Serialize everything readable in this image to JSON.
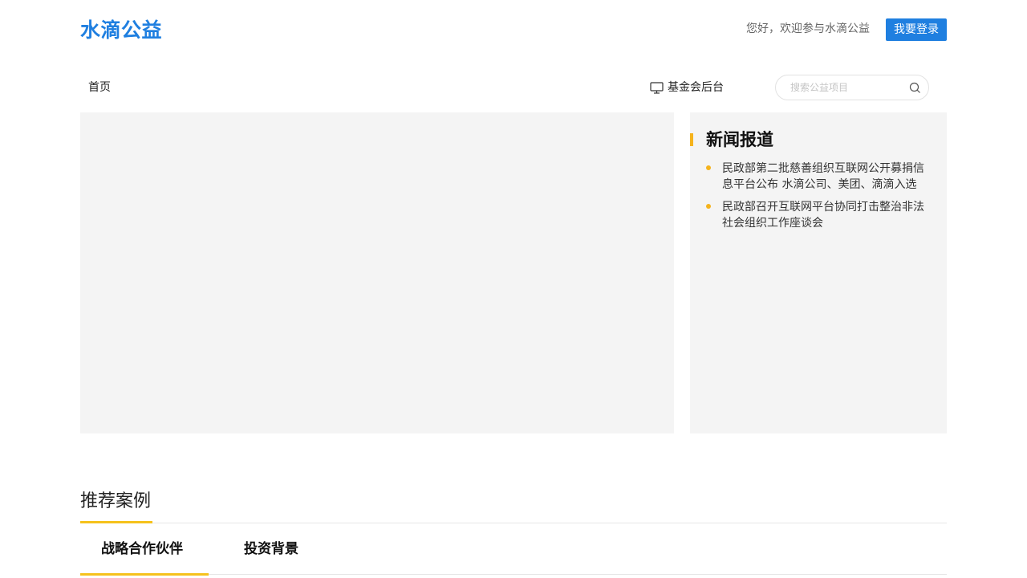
{
  "header": {
    "logo": "水滴公益",
    "greeting": "您好，欢迎参与水滴公益",
    "login_label": "我要登录"
  },
  "nav": {
    "home_label": "首页",
    "admin_label": "基金会后台",
    "search_placeholder": "搜索公益项目"
  },
  "news": {
    "title": "新闻报道",
    "items": [
      "民政部第二批慈善组织互联网公开募捐信息平台公布 水滴公司、美团、滴滴入选",
      "民政部召开互联网平台协同打击整治非法社会组织工作座谈会"
    ]
  },
  "recommended": {
    "title": "推荐案例",
    "tabs": [
      "战略合作伙伴",
      "投资背景"
    ],
    "active_tab": 0
  },
  "colors": {
    "brand_blue": "#1f7fe0",
    "accent_yellow": "#f5b31c",
    "panel_bg": "#f4f4f4"
  },
  "icons": {
    "admin": "monitor-icon",
    "search": "search-icon"
  }
}
